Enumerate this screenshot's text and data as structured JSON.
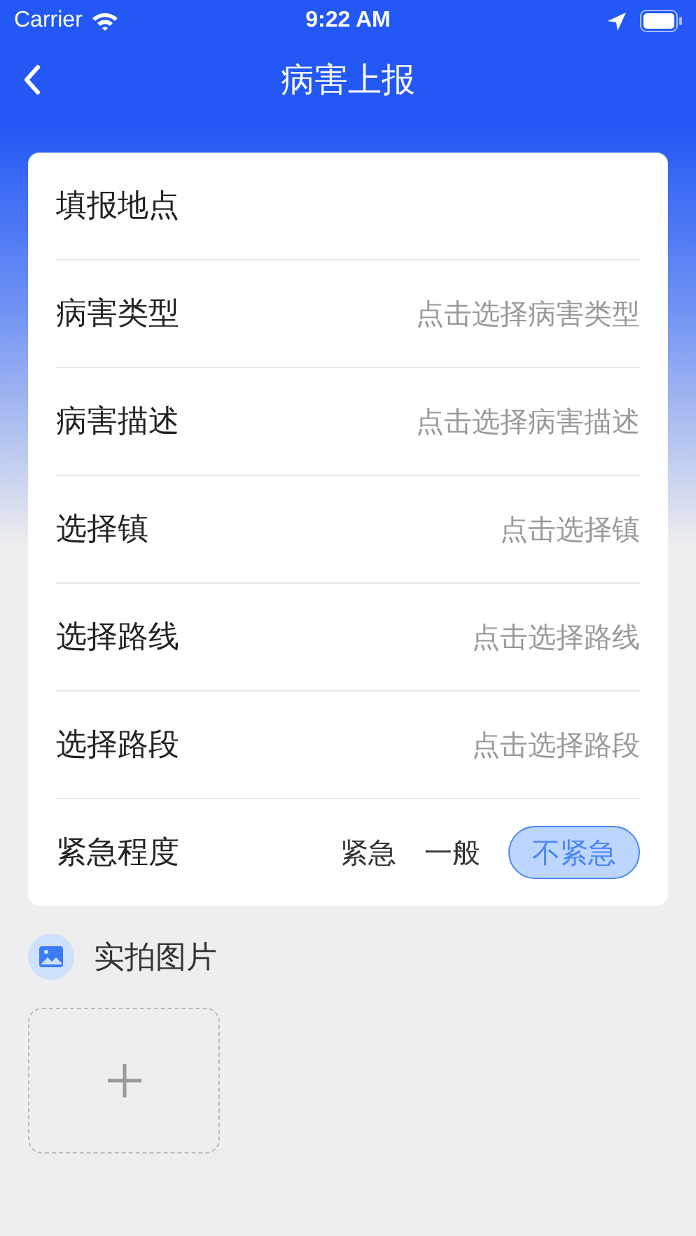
{
  "status_bar": {
    "carrier": "Carrier",
    "time": "9:22 AM"
  },
  "nav": {
    "title": "病害上报"
  },
  "form": {
    "rows": [
      {
        "kind": "plain",
        "label": "填报地点"
      },
      {
        "kind": "picker",
        "label": "病害类型",
        "placeholder": "点击选择病害类型"
      },
      {
        "kind": "picker",
        "label": "病害描述",
        "placeholder": "点击选择病害描述"
      },
      {
        "kind": "picker",
        "label": "选择镇",
        "placeholder": "点击选择镇"
      },
      {
        "kind": "picker",
        "label": "选择路线",
        "placeholder": "点击选择路线"
      },
      {
        "kind": "picker",
        "label": "选择路段",
        "placeholder": "点击选择路段"
      },
      {
        "kind": "choice",
        "label": "紧急程度",
        "options": [
          {
            "label": "紧急",
            "selected": false
          },
          {
            "label": "一般",
            "selected": false
          },
          {
            "label": "不紧急",
            "selected": true
          }
        ]
      }
    ]
  },
  "photos": {
    "title": "实拍图片"
  }
}
